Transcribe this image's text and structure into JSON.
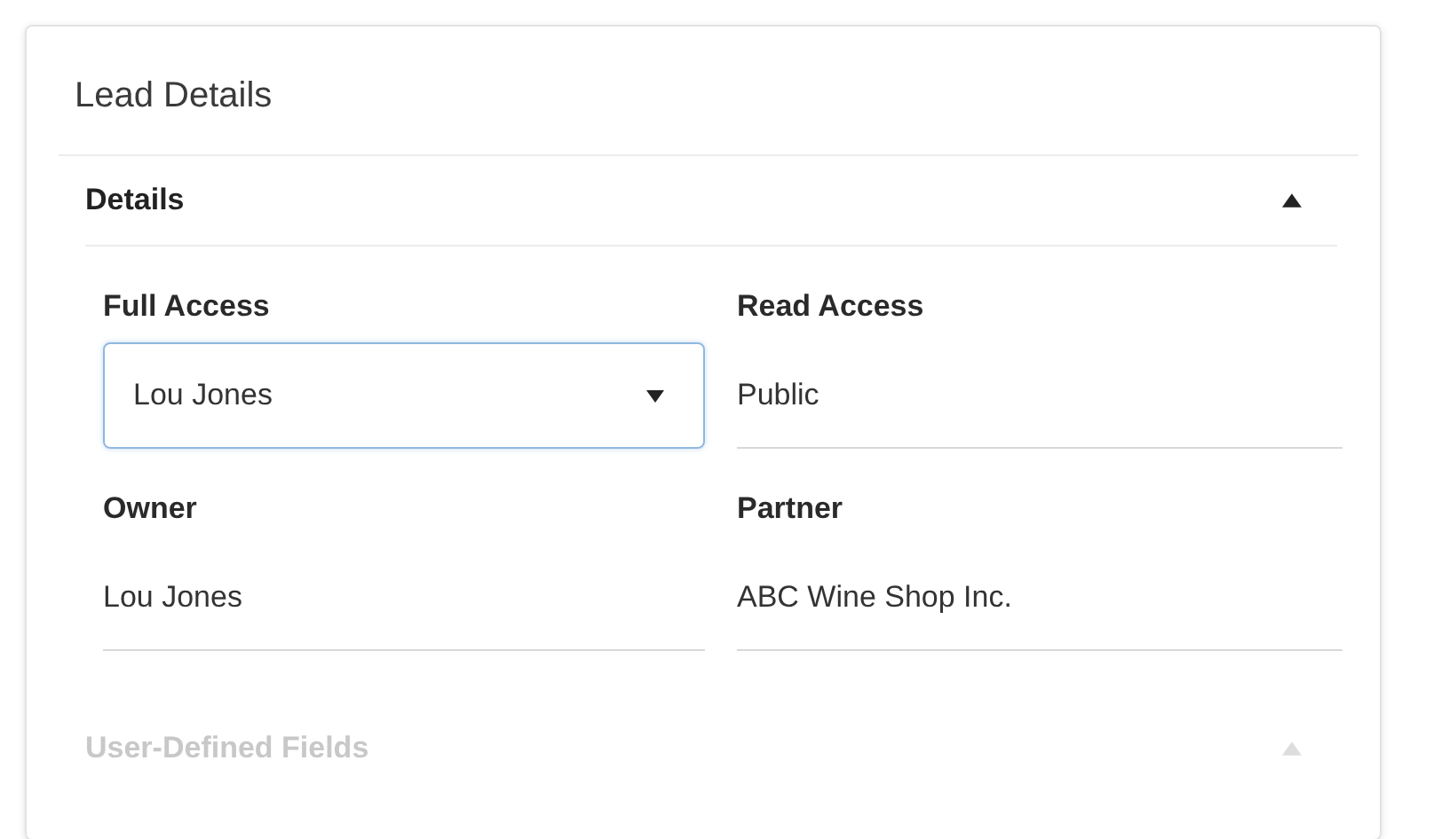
{
  "card": {
    "title": "Lead Details"
  },
  "sections": [
    {
      "title": "Details",
      "expanded": true,
      "fields": [
        {
          "label": "Full Access",
          "kind": "select",
          "value": "Lou Jones",
          "focused": true
        },
        {
          "label": "Read Access",
          "kind": "text",
          "value": "Public",
          "focused": false
        },
        {
          "label": "Owner",
          "kind": "text",
          "value": "Lou Jones",
          "focused": false
        },
        {
          "label": "Partner",
          "kind": "text",
          "value": "ABC Wine Shop Inc.",
          "focused": false
        }
      ]
    },
    {
      "title": "User-Defined Fields",
      "expanded": true
    }
  ]
}
